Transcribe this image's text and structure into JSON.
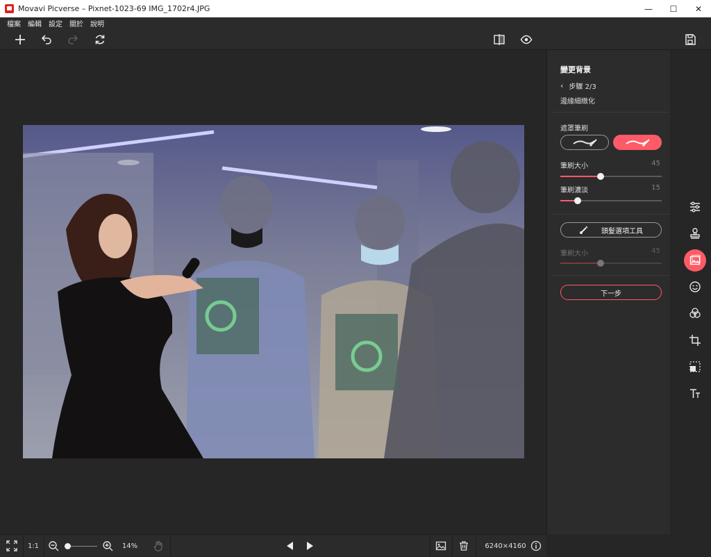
{
  "window": {
    "title": "Movavi Picverse – Pixnet-1023-69 IMG_1702r4.JPG",
    "minimize": "—",
    "maximize": "☐",
    "close": "✕"
  },
  "menu": [
    "檔案",
    "編輯",
    "設定",
    "關於",
    "說明"
  ],
  "panel": {
    "title": "變更背景",
    "step": "步驟 2/3",
    "step_subtitle": "邊緣細緻化",
    "mask_brush_label": "遮罩筆刷",
    "brush_size_label": "筆刷大小",
    "brush_size_value": "45",
    "brush_size_fraction": 0.4,
    "brush_opacity_label": "筆刷濃淡",
    "brush_opacity_value": "15",
    "brush_opacity_fraction": 0.17,
    "hair_tool_label": "頭髮選項工具",
    "hair_brush_size_label": "筆刷大小",
    "hair_brush_size_value": "45",
    "hair_brush_size_fraction": 0.4,
    "next_button": "下一步"
  },
  "bottom": {
    "ratio_label": "1:1",
    "zoom_percent": "14%",
    "zoom_fraction": 0.05,
    "image_size": "6240×4160"
  },
  "colors": {
    "accent": "#ff5a67"
  }
}
